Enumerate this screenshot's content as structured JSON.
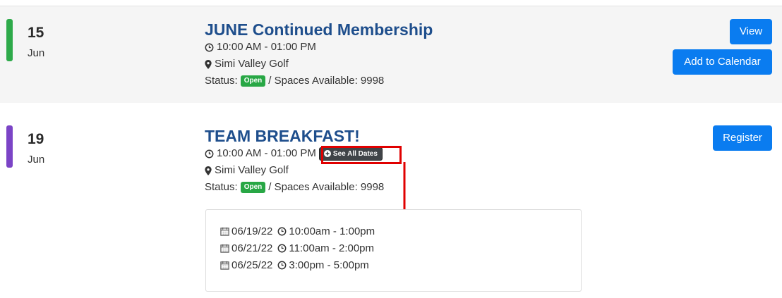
{
  "events": [
    {
      "day": "15",
      "month": "Jun",
      "title": "JUNE Continued Membership",
      "time": "10:00 AM - 01:00 PM",
      "location": "Simi Valley Golf",
      "status_label": "Status:",
      "status_badge": "Open",
      "spaces_text": "/ Spaces Available: 9998",
      "buttons": {
        "view": "View",
        "calendar": "Add to Calendar"
      },
      "accent_color": "#2eaa4a"
    },
    {
      "day": "19",
      "month": "Jun",
      "title": "TEAM BREAKFAST!",
      "time": "10:00 AM - 01:00 PM",
      "see_all": "See All Dates",
      "location": "Simi Valley Golf",
      "status_label": "Status:",
      "status_badge": "Open",
      "spaces_text": "/ Spaces Available: 9998",
      "buttons": {
        "register": "Register"
      },
      "accent_color": "#7b44c6",
      "dates": [
        {
          "date": "06/19/22",
          "time": "10:00am - 1:00pm"
        },
        {
          "date": "06/21/22",
          "time": "11:00am - 2:00pm"
        },
        {
          "date": "06/25/22",
          "time": "3:00pm - 5:00pm"
        }
      ]
    }
  ],
  "colors": {
    "title": "#1e4e8c",
    "button": "#0a7cf0",
    "open_badge": "#28a745",
    "annotation": "#e00000"
  },
  "icons": [
    "clock-icon",
    "map-marker-icon",
    "plus-circle-icon",
    "calendar-icon"
  ]
}
